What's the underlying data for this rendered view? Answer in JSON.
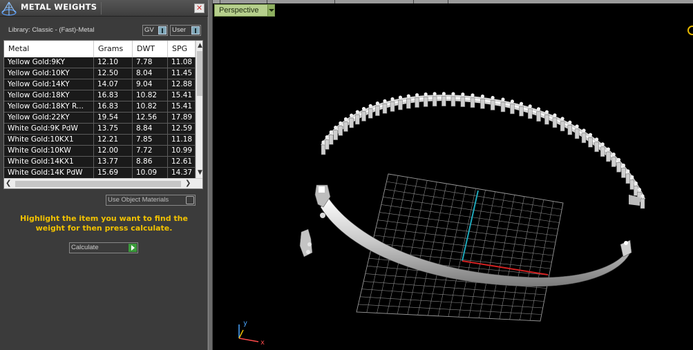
{
  "panel": {
    "title": "METAL WEIGHTS",
    "close_glyph": "✕",
    "library_label": "Library: Classic - (Fast)-Metal",
    "toggles": {
      "gv": "GV",
      "user": "User"
    },
    "table": {
      "columns": [
        "Metal",
        "Grams",
        "DWT",
        "SPG"
      ],
      "rows": [
        [
          "Yellow Gold:9KY",
          "12.10",
          "7.78",
          "11.08"
        ],
        [
          "Yellow Gold:10KY",
          "12.50",
          "8.04",
          "11.45"
        ],
        [
          "Yellow Gold:14KY",
          "14.07",
          "9.04",
          "12.88"
        ],
        [
          "Yellow Gold:18KY",
          "16.83",
          "10.82",
          "15.41"
        ],
        [
          "Yellow Gold:18KY R...",
          "16.83",
          "10.82",
          "15.41"
        ],
        [
          "Yellow Gold:22KY",
          "19.54",
          "12.56",
          "17.89"
        ],
        [
          "White Gold:9K PdW",
          "13.75",
          "8.84",
          "12.59"
        ],
        [
          "White Gold:10KX1",
          "12.21",
          "7.85",
          "11.18"
        ],
        [
          "White Gold:10KW",
          "12.00",
          "7.72",
          "10.99"
        ],
        [
          "White Gold:14KX1",
          "13.77",
          "8.86",
          "12.61"
        ],
        [
          "White Gold:14K PdW",
          "15.69",
          "10.09",
          "14.37"
        ]
      ]
    },
    "use_object_materials": "Use Object Materials",
    "hint": "Highlight the item you want to find the weight for then press calculate.",
    "calculate_label": "Calculate"
  },
  "viewport": {
    "view_mode": "Perspective",
    "axis_labels": {
      "y": "y",
      "x": "x"
    }
  },
  "icons": {
    "app_logo": "wireframe-cone-logo",
    "close": "close-icon",
    "dropdown": "chevron-down-icon",
    "play": "play-arrow-icon"
  },
  "colors": {
    "hint_text": "#f2c200",
    "perspective_tab": "#b6cf8c",
    "calculate_arrow": "#3a9a3a",
    "grid_y_axis": "#1fa6b8",
    "grid_x_axis": "#d42222"
  }
}
